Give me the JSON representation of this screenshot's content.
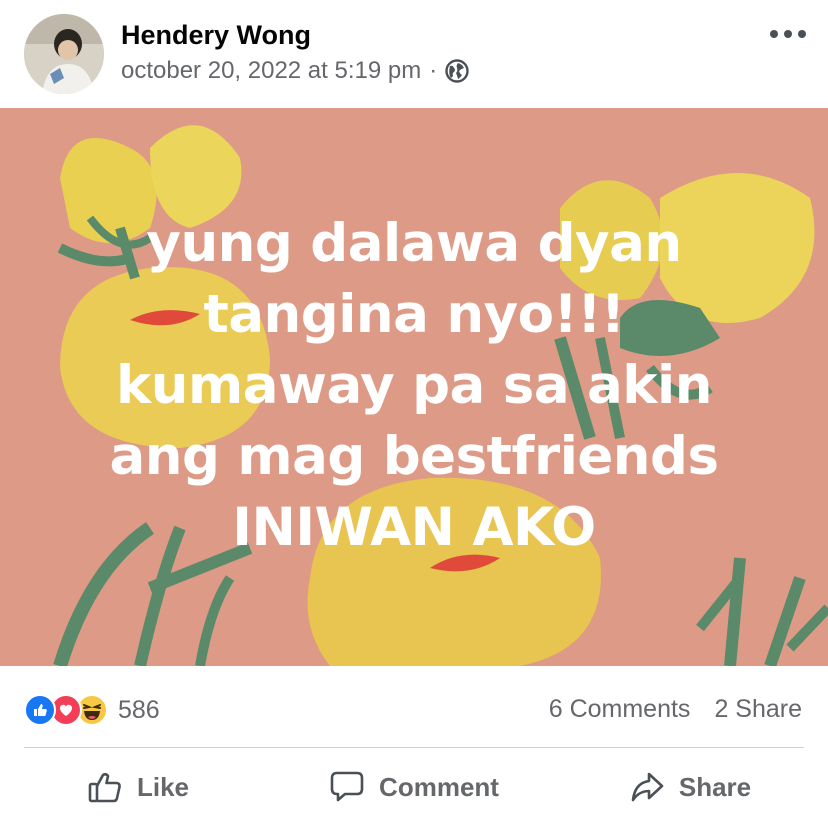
{
  "post": {
    "author": "Hendery Wong",
    "timestamp": "october 20, 2022 at 5:19 pm",
    "separator": "·",
    "privacy_icon": "globe-icon",
    "more_icon": "more-options-icon",
    "text_lines": [
      "yung dalawa dyan",
      "tangina nyo!!!",
      "kumaway pa sa akin",
      "ang mag bestfriends",
      "INIWAN AKO"
    ],
    "background_color": "#dd9a86"
  },
  "stats": {
    "reaction_icons": [
      "like-reaction-icon",
      "love-reaction-icon",
      "haha-reaction-icon"
    ],
    "reaction_count": "586",
    "comments": "6 Comments",
    "shares": "2 Share"
  },
  "actions": {
    "like": "Like",
    "comment": "Comment",
    "share": "Share"
  },
  "colors": {
    "like_blue": "#1877f2",
    "love_red": "#f33e58",
    "haha_yellow": "#f7c844",
    "secondary_text": "#65676b"
  }
}
